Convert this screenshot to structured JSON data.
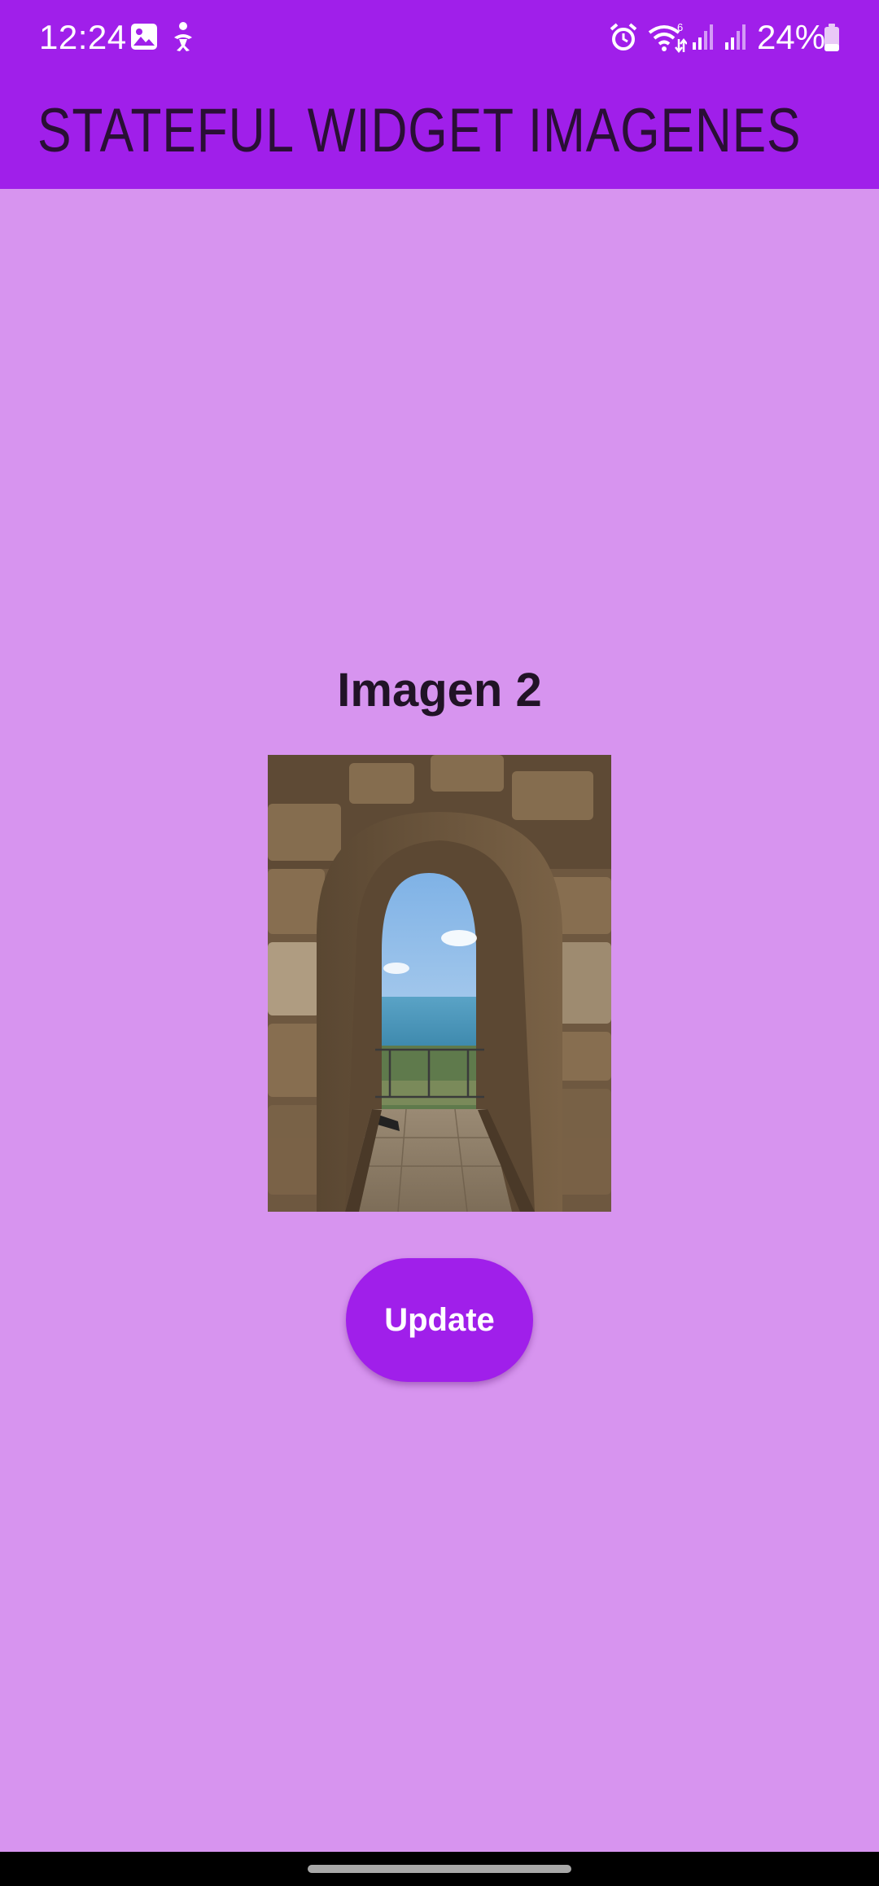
{
  "status_bar": {
    "time": "12:24",
    "battery_percent": "24%",
    "icons": [
      "image-icon",
      "accessibility-icon",
      "alarm-icon",
      "wifi-6-icon",
      "signal-icon",
      "signal-icon",
      "battery-icon"
    ]
  },
  "app_bar": {
    "title": "STATEFUL WIDGET IMAGENES"
  },
  "main": {
    "caption": "Imagen 2",
    "update_label": "Update"
  },
  "colors": {
    "primary": "#a01fea",
    "background": "#d794ef",
    "title_text": "#2a0f35"
  }
}
